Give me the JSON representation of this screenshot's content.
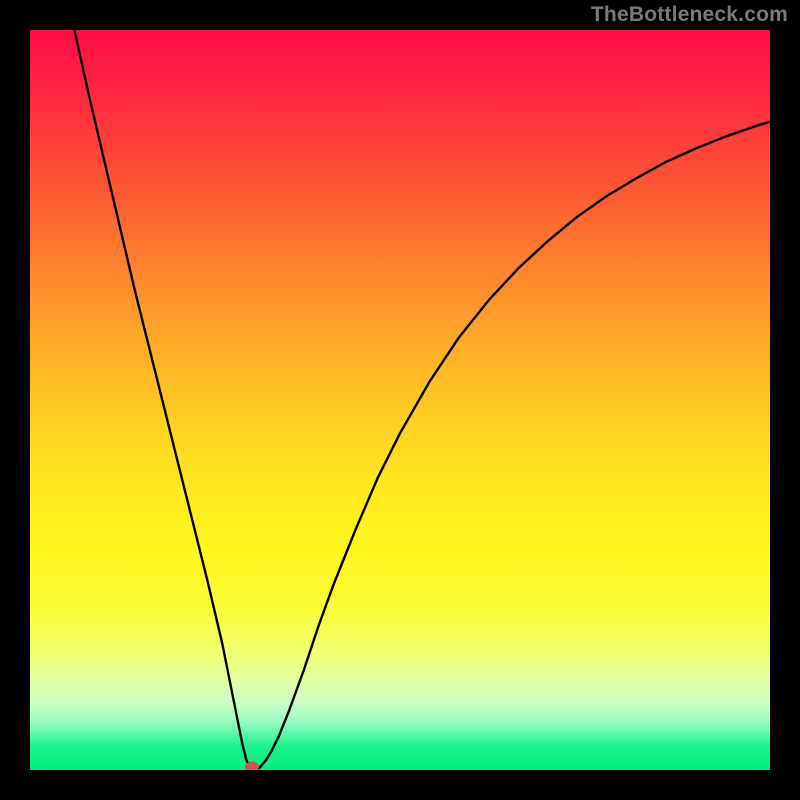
{
  "watermark": "TheBottleneck.com",
  "chart_data": {
    "type": "line",
    "title": "",
    "xlabel": "",
    "ylabel": "",
    "xlim": [
      0,
      100
    ],
    "ylim": [
      0,
      100
    ],
    "grid": false,
    "curve": {
      "min_x": 30,
      "min_y": 0,
      "points": [
        {
          "x": 6.0,
          "y": 100.0
        },
        {
          "x": 8.0,
          "y": 91.0
        },
        {
          "x": 10.0,
          "y": 82.5
        },
        {
          "x": 12.0,
          "y": 74.0
        },
        {
          "x": 14.0,
          "y": 65.5
        },
        {
          "x": 16.0,
          "y": 57.5
        },
        {
          "x": 18.0,
          "y": 49.5
        },
        {
          "x": 20.0,
          "y": 41.5
        },
        {
          "x": 22.0,
          "y": 33.5
        },
        {
          "x": 24.0,
          "y": 25.5
        },
        {
          "x": 26.0,
          "y": 17.0
        },
        {
          "x": 27.0,
          "y": 12.0
        },
        {
          "x": 28.0,
          "y": 7.0
        },
        {
          "x": 28.7,
          "y": 3.5
        },
        {
          "x": 29.2,
          "y": 1.5
        },
        {
          "x": 29.6,
          "y": 0.5
        },
        {
          "x": 30.0,
          "y": 0.0
        },
        {
          "x": 30.5,
          "y": 0.0
        },
        {
          "x": 31.1,
          "y": 0.4
        },
        {
          "x": 31.8,
          "y": 1.2
        },
        {
          "x": 32.6,
          "y": 2.5
        },
        {
          "x": 33.6,
          "y": 4.5
        },
        {
          "x": 35.0,
          "y": 8.0
        },
        {
          "x": 37.0,
          "y": 13.5
        },
        {
          "x": 39.0,
          "y": 19.5
        },
        {
          "x": 41.0,
          "y": 25.0
        },
        {
          "x": 44.0,
          "y": 32.5
        },
        {
          "x": 47.0,
          "y": 39.5
        },
        {
          "x": 50.0,
          "y": 45.5
        },
        {
          "x": 54.0,
          "y": 52.5
        },
        {
          "x": 58.0,
          "y": 58.5
        },
        {
          "x": 62.0,
          "y": 63.5
        },
        {
          "x": 66.0,
          "y": 67.8
        },
        {
          "x": 70.0,
          "y": 71.5
        },
        {
          "x": 74.0,
          "y": 74.8
        },
        {
          "x": 78.0,
          "y": 77.6
        },
        {
          "x": 82.0,
          "y": 80.0
        },
        {
          "x": 86.0,
          "y": 82.2
        },
        {
          "x": 90.0,
          "y": 84.0
        },
        {
          "x": 94.0,
          "y": 85.6
        },
        {
          "x": 98.0,
          "y": 87.0
        },
        {
          "x": 100.0,
          "y": 87.6
        }
      ]
    },
    "min_marker": {
      "x": 30,
      "y": 0,
      "color": "#d0564d"
    },
    "background_gradient": {
      "top": "#ff0b46",
      "bottom": "#02ee80"
    }
  }
}
